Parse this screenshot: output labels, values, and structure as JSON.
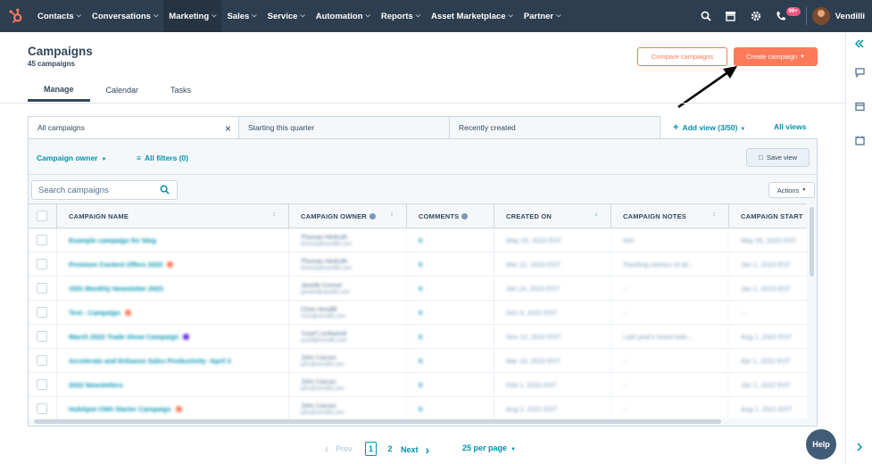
{
  "nav": {
    "items": [
      {
        "label": "Contacts"
      },
      {
        "label": "Conversations"
      },
      {
        "label": "Marketing",
        "active": true
      },
      {
        "label": "Sales"
      },
      {
        "label": "Service"
      },
      {
        "label": "Automation"
      },
      {
        "label": "Reports"
      },
      {
        "label": "Asset Marketplace"
      },
      {
        "label": "Partner"
      }
    ],
    "notif_badge": "99+",
    "account_name": "Vendilli"
  },
  "header": {
    "title": "Campaigns",
    "subtitle": "45 campaigns",
    "compare_label": "Compare campaigns",
    "create_label": "Create campaign"
  },
  "tabs": [
    {
      "label": "Manage",
      "active": true
    },
    {
      "label": "Calendar"
    },
    {
      "label": "Tasks"
    }
  ],
  "views": {
    "tabs": [
      {
        "label": "All campaigns",
        "active": true
      },
      {
        "label": "Starting this quarter"
      },
      {
        "label": "Recently created"
      }
    ],
    "add_view_label": "Add view (3/50)",
    "all_views_label": "All views"
  },
  "filters": {
    "owner_label": "Campaign owner",
    "all_filters_label": "All filters (0)",
    "save_view_label": "Save view"
  },
  "search": {
    "placeholder": "Search campaigns"
  },
  "actions_label": "Actions",
  "table": {
    "columns": [
      "CAMPAIGN NAME",
      "CAMPAIGN OWNER",
      "COMMENTS",
      "CREATED ON",
      "CAMPAIGN NOTES",
      "CAMPAIGN START"
    ],
    "rows": [
      {
        "name": "Example campaign for blog",
        "dot": "",
        "owner": "Thomas Hedroth",
        "email": "thomas@vendilli.com",
        "comments": "0",
        "created": "May 26, 2023 EST",
        "notes": "N/A",
        "start": "May 26, 2023 EST"
      },
      {
        "name": "Premium Content Offers 2023",
        "dot": "#ff7a59",
        "owner": "Thomas Hedroth",
        "email": "thomas@vendilli.com",
        "comments": "0",
        "created": "Mar 21, 2023 EST",
        "notes": "Tracking metrics of all...",
        "start": "Jan 1, 2023 EST"
      },
      {
        "name": "VDG Monthly Newsletter 2023",
        "dot": "",
        "owner": "Janelle Conner",
        "email": "janelle@vendilli.com",
        "comments": "0",
        "created": "Jan 24, 2023 EST",
        "notes": "--",
        "start": "Jan 1, 2023 EST"
      },
      {
        "name": "Test - Campaign",
        "dot": "#ff7a59",
        "owner": "Chris Vendilli",
        "email": "chris@vendilli.com",
        "comments": "0",
        "created": "Dec 9, 2022 EST",
        "notes": "--",
        "start": "--"
      },
      {
        "name": "March 2022 Trade Show Campaign",
        "dot": "#5c2ed9",
        "owner": "Yusef Lockwood",
        "email": "yusef@vendilli.com",
        "comments": "0",
        "created": "Nov 12, 2022 EST",
        "notes": "Last year's event was...",
        "start": "Aug 1, 2022 EST"
      },
      {
        "name": "Accelerate and Enhance Sales Productivity -April 3",
        "dot": "",
        "owner": "John Caruso",
        "email": "john@vendilli.com",
        "comments": "0",
        "created": "Mar 15, 2022 EST",
        "notes": "--",
        "start": "Apr 1, 2022 EST"
      },
      {
        "name": "2022 Newsletters",
        "dot": "",
        "owner": "John Caruso",
        "email": "john@vendilli.com",
        "comments": "0",
        "created": "Feb 1, 2022 EST",
        "notes": "--",
        "start": "Jan 1, 2022 EST"
      },
      {
        "name": "HubSpot CMS Starter Campaign",
        "dot": "#ff7a59",
        "owner": "John Caruso",
        "email": "john@vendilli.com",
        "comments": "0",
        "created": "Aug 2, 2021 EST",
        "notes": "--",
        "start": "Aug 1, 2021 EST"
      }
    ]
  },
  "pagination": {
    "prev_label": "Prev",
    "current_page": "1",
    "next_page": "2",
    "next_label": "Next",
    "per_page_label": "25 per page"
  },
  "help_label": "Help",
  "colors": {
    "nav_bg": "#2d3e50",
    "accent": "#ff7a59",
    "link": "#0091ae"
  }
}
